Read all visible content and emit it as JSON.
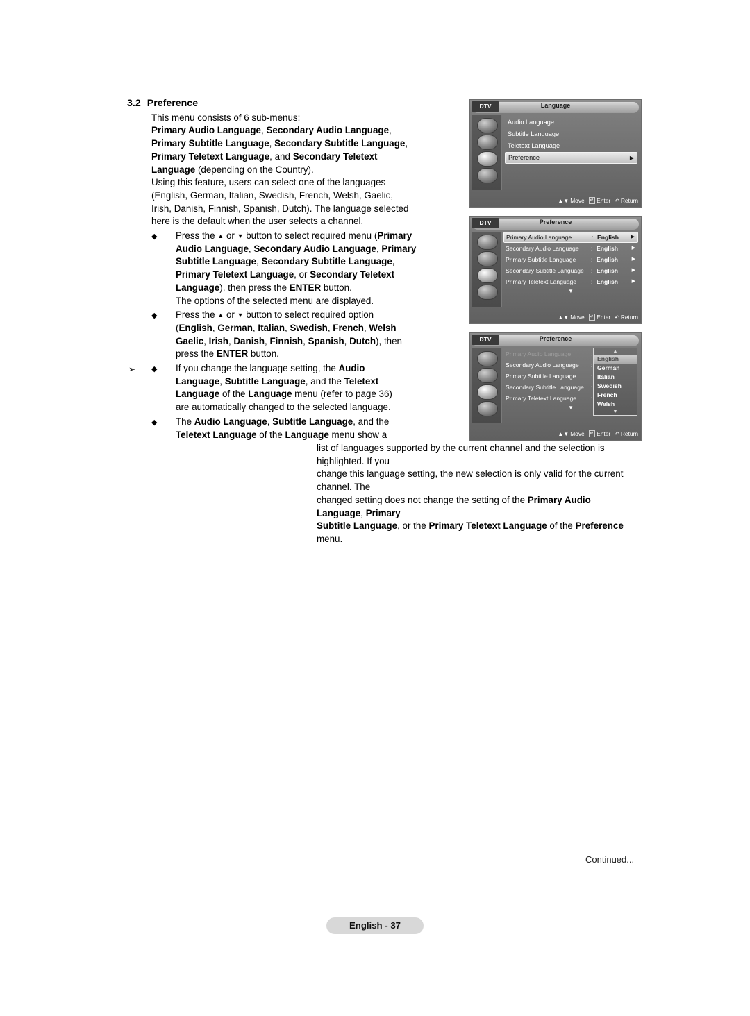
{
  "section": {
    "number": "3.2",
    "title": "Preference",
    "intro": "This menu consists of 6 sub-menus:",
    "submenus_line1_b1": "Primary Audio Language",
    "submenus_line1_sep1": ", ",
    "submenus_line1_b2": "Secondary Audio Language",
    "submenus_line1_end": ",",
    "submenus_line2_b1": "Primary Subtitle Language",
    "submenus_line2_sep1": ", ",
    "submenus_line2_b2": "Secondary Subtitle Language",
    "submenus_line2_end": ",",
    "submenus_line3_b1": "Primary Teletext Language",
    "submenus_line3_sep1": ", and ",
    "submenus_line3_b2": "Secondary Teletext",
    "submenus_line4_b1": "Language",
    "submenus_line4_rest": " (depending on the Country).",
    "feature_p1": "Using this feature, users can select one of the languages",
    "feature_p2": "(English, German, Italian, Swedish, French, Welsh, Gaelic,",
    "feature_p3": "Irish, Danish, Finnish, Spanish, Dutch). The language selected",
    "feature_p4": "here is the default when the user selects a channel."
  },
  "bullets": {
    "b1": {
      "lead_1": "Press the ",
      "up": "▲",
      "mid": " or ",
      "down": "▼",
      "lead_2": " button to select required menu (",
      "bold_primary": "Primary",
      "l2_b1": "Audio Language",
      "l2_s1": ", ",
      "l2_b2": "Secondary Audio Language",
      "l2_s2": ", ",
      "l2_b3": "Primary",
      "l3_b1": "Subtitle Language",
      "l3_s1": ", ",
      "l3_b2": "Secondary Subtitle Language",
      "l3_end": ",",
      "l4_b1": "Primary Teletext Language",
      "l4_s1": ", or ",
      "l4_b2": "Secondary Teletext",
      "l5_b1": "Language",
      "l5_mid": "), then press the ",
      "l5_b2": "ENTER",
      "l5_end": " button.",
      "sub": "The options of the selected menu are displayed."
    },
    "b2": {
      "lead_1": "Press the ",
      "up": "▲",
      "mid": " or ",
      "down": "▼",
      "lead_2": " button to select required option",
      "l2_open": "(",
      "l2_items": [
        "English",
        "German",
        "Italian",
        "Swedish",
        "French",
        "Welsh"
      ],
      "l3_items": [
        "Gaelic",
        "Irish",
        "Danish",
        "Finnish",
        "Spanish",
        "Dutch"
      ],
      "l3_end": "), then",
      "l4_pre": "press the ",
      "l4_b": "ENTER",
      "l4_end": " button."
    },
    "note": {
      "arrow": "➢",
      "l1_pre": "If you change the language setting, the ",
      "l1_b": "Audio",
      "l2_b1": "Language",
      "l2_s1": ", ",
      "l2_b2": "Subtitle Language",
      "l2_s2": ", and the ",
      "l2_b3": "Teletext",
      "l3_b1": "Language",
      "l3_s1": " of the ",
      "l3_b2": "Language",
      "l3_end": " menu (refer to page 36)",
      "l4": "are automatically changed to the selected language."
    },
    "b3": {
      "l1_pre": "The ",
      "l1_b1": "Audio Language",
      "l1_s1": ", ",
      "l1_b2": "Subtitle Language",
      "l1_s2": ", and the",
      "l2_b1": "Teletext Language",
      "l2_s1": " of the ",
      "l2_b2": "Language",
      "l2_end": " menu show a"
    }
  },
  "wide_para": {
    "l1": "list of languages supported by the current channel and the selection is highlighted. If you",
    "l2": "change this language setting, the new selection is only valid for the current channel. The",
    "l3_pre": "changed setting does not change the setting of the ",
    "l3_b1": "Primary Audio Language",
    "l3_s1": ", ",
    "l3_b2": "Primary",
    "l4_b1": "Subtitle Language",
    "l4_s1": ", or the ",
    "l4_b2": "Primary Teletext Language",
    "l4_s2": " of the ",
    "l4_b3": "Preference",
    "l4_end": " menu."
  },
  "osd": {
    "panel1": {
      "dtv": "DTV",
      "title": "Language",
      "rows": [
        {
          "label": "Audio Language",
          "highlight": false
        },
        {
          "label": "Subtitle Language",
          "highlight": false
        },
        {
          "label": "Teletext Language",
          "highlight": false
        },
        {
          "label": "Preference",
          "highlight": true
        }
      ],
      "footer": {
        "move": "Move",
        "enter": "Enter",
        "return": "Return"
      }
    },
    "panel2": {
      "dtv": "DTV",
      "title": "Preference",
      "rows": [
        {
          "label": "Primary Audio Language",
          "value": "English",
          "highlight": true
        },
        {
          "label": "Secondary Audio Language",
          "value": "English",
          "highlight": false
        },
        {
          "label": "Primary Subtitle Language",
          "value": "English",
          "highlight": false
        },
        {
          "label": "Secondary Subtitle Language",
          "value": "English",
          "highlight": false
        },
        {
          "label": "Primary Teletext Language",
          "value": "English",
          "highlight": false
        }
      ],
      "more": "▼",
      "footer": {
        "move": "Move",
        "enter": "Enter",
        "return": "Return"
      }
    },
    "panel3": {
      "dtv": "DTV",
      "title": "Preference",
      "rows": [
        {
          "label": "Primary Audio Language",
          "value": ":",
          "dim": true
        },
        {
          "label": "Secondary Audio Language",
          "value": ":",
          "dim": false
        },
        {
          "label": "Primary Subtitle Language",
          "value": ":",
          "dim": false
        },
        {
          "label": "Secondary Subtitle Language",
          "value": ":",
          "dim": false
        },
        {
          "label": "Primary Teletext Language",
          "value": ":",
          "dim": false
        }
      ],
      "more": "▼",
      "dropdown": {
        "up": "▲",
        "down": "▼",
        "items": [
          {
            "label": "English",
            "selected": true
          },
          {
            "label": "German",
            "selected": false
          },
          {
            "label": "Italian",
            "selected": false
          },
          {
            "label": "Swedish",
            "selected": false
          },
          {
            "label": "French",
            "selected": false
          },
          {
            "label": "Welsh",
            "selected": false
          }
        ]
      },
      "footer": {
        "move": "Move",
        "enter": "Enter",
        "return": "Return"
      }
    }
  },
  "footer": {
    "continued": "Continued...",
    "page_badge": "English - 37"
  }
}
